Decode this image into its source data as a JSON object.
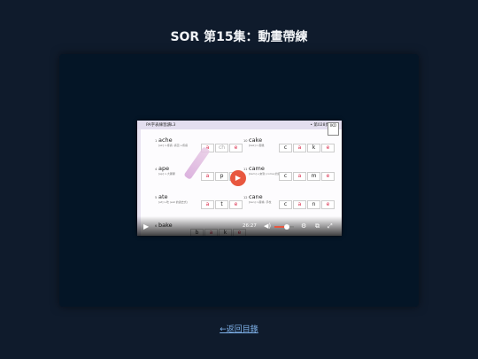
{
  "page": {
    "title": "SOR 第15集：動畫帶練",
    "back_link": "←返回目錄"
  },
  "video": {
    "slide_title": "PA字表練習讀L3",
    "slide_page": "• 第028頁",
    "corner_badge": "IKO",
    "time": "26:27",
    "volume_level": 0.65,
    "words": [
      {
        "num": "1",
        "word": "ache",
        "sub": "[ek]  n.疼痛; 痛苦 v.疼痛",
        "tiles": [
          "a",
          "ch",
          "e"
        ]
      },
      {
        "num": "10",
        "word": "cake",
        "sub": "[kek]  n.蛋糕",
        "tiles": [
          "c",
          "a",
          "k",
          "e"
        ]
      },
      {
        "num": "4",
        "word": "ape",
        "sub": "[ep]  n.大猩猩",
        "tiles": [
          "a",
          "p",
          "e"
        ]
      },
      {
        "num": "11",
        "word": "came",
        "sub": "[kem]  v.來到 (come 的過去式)",
        "tiles": [
          "c",
          "a",
          "m",
          "e"
        ]
      },
      {
        "num": "5",
        "word": "ate",
        "sub": "[et]  v.吃 (eat 的過去式)",
        "tiles": [
          "a",
          "t",
          "e"
        ]
      },
      {
        "num": "12",
        "word": "cane",
        "sub": "[ken]  n.藤條; 手杖",
        "tiles": [
          "c",
          "a",
          "n",
          "e"
        ]
      },
      {
        "num": "6",
        "word": "bake",
        "sub": "",
        "tiles": [
          "b",
          "a",
          "k",
          "e"
        ]
      }
    ]
  }
}
